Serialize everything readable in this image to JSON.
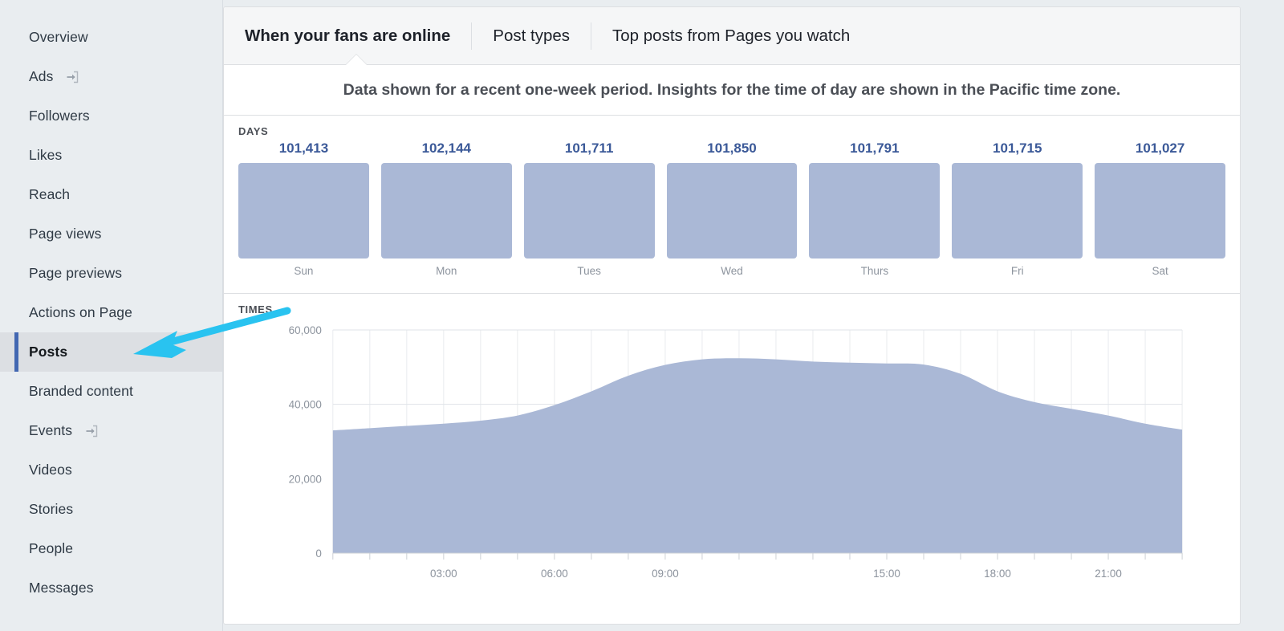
{
  "sidebar": {
    "items": [
      {
        "label": "Overview",
        "icon": null,
        "active": false
      },
      {
        "label": "Ads",
        "icon": "external-link",
        "active": false
      },
      {
        "label": "Followers",
        "icon": null,
        "active": false
      },
      {
        "label": "Likes",
        "icon": null,
        "active": false
      },
      {
        "label": "Reach",
        "icon": null,
        "active": false
      },
      {
        "label": "Page views",
        "icon": null,
        "active": false
      },
      {
        "label": "Page previews",
        "icon": null,
        "active": false
      },
      {
        "label": "Actions on Page",
        "icon": null,
        "active": false
      },
      {
        "label": "Posts",
        "icon": null,
        "active": true
      },
      {
        "label": "Branded content",
        "icon": null,
        "active": false
      },
      {
        "label": "Events",
        "icon": "external-link",
        "active": false
      },
      {
        "label": "Videos",
        "icon": null,
        "active": false
      },
      {
        "label": "Stories",
        "icon": null,
        "active": false
      },
      {
        "label": "People",
        "icon": null,
        "active": false
      },
      {
        "label": "Messages",
        "icon": null,
        "active": false
      }
    ]
  },
  "tabs": [
    {
      "label": "When your fans are online",
      "active": true
    },
    {
      "label": "Post types",
      "active": false
    },
    {
      "label": "Top posts from Pages you watch",
      "active": false
    }
  ],
  "banner": {
    "text": "Data shown for a recent one-week period. Insights for the time of day are shown in the Pacific time zone."
  },
  "days_section": {
    "title": "DAYS"
  },
  "times_section": {
    "title": "TIMES"
  },
  "colors": {
    "bar_fill": "#aab8d6",
    "value_text": "#3b5998",
    "active_marker": "#4267b2",
    "annotation_arrow": "#29c3f0",
    "panel_bg": "#ffffff",
    "sidebar_bg": "#e9edf0"
  },
  "annotation": {
    "type": "arrow",
    "points_to": "Posts"
  },
  "chart_data": [
    {
      "type": "bar",
      "title": "DAYS",
      "categories": [
        "Sun",
        "Mon",
        "Tues",
        "Wed",
        "Thurs",
        "Fri",
        "Sat"
      ],
      "values": [
        101413,
        102144,
        101711,
        101850,
        101791,
        101715,
        101027
      ],
      "value_labels": [
        "101,413",
        "102,144",
        "101,711",
        "101,850",
        "101,791",
        "101,715",
        "101,027"
      ],
      "xlabel": "",
      "ylabel": "",
      "grid": false,
      "note": "Bars are drawn at uniform height; the printed value label carries the data."
    },
    {
      "type": "area",
      "title": "TIMES",
      "xlabel": "",
      "ylabel": "",
      "ylim": [
        0,
        60000
      ],
      "yticks": [
        0,
        20000,
        40000,
        60000
      ],
      "ytick_labels": [
        "0",
        "20,000",
        "40,000",
        "60,000"
      ],
      "xticks": [
        "03:00",
        "06:00",
        "09:00",
        "15:00",
        "18:00",
        "21:00"
      ],
      "xtick_hours": [
        3,
        6,
        9,
        15,
        18,
        21
      ],
      "grid": true,
      "x": [
        0,
        1,
        2,
        3,
        4,
        5,
        6,
        7,
        8,
        9,
        10,
        11,
        12,
        13,
        14,
        15,
        16,
        17,
        18,
        19,
        20,
        21,
        22,
        23
      ],
      "values": [
        33000,
        33600,
        34200,
        34800,
        35600,
        37000,
        39800,
        43500,
        47700,
        50600,
        52100,
        52400,
        52100,
        51500,
        51200,
        51000,
        50700,
        48200,
        43500,
        40600,
        38800,
        37000,
        34800,
        33200
      ],
      "series_name": "Fans online"
    }
  ]
}
